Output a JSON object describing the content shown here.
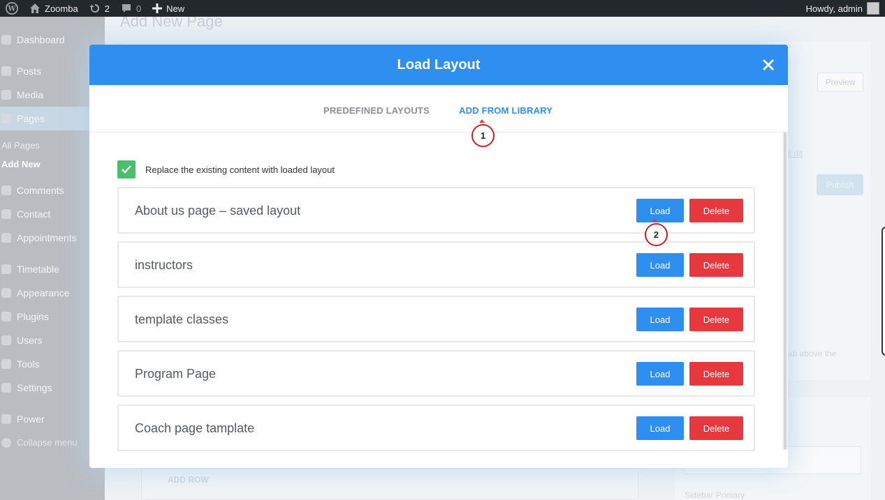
{
  "adminbar": {
    "site_name": "Zoomba",
    "updates_count": "2",
    "comments_count": "0",
    "new_label": "New",
    "greeting": "Howdy, admin"
  },
  "sidebar": {
    "items": [
      {
        "label": "Dashboard"
      },
      {
        "label": "Posts"
      },
      {
        "label": "Media"
      },
      {
        "label": "Pages"
      },
      {
        "label": "Comments"
      },
      {
        "label": "Contact"
      },
      {
        "label": "Appointments"
      },
      {
        "label": "Timetable"
      },
      {
        "label": "Appearance"
      },
      {
        "label": "Plugins"
      },
      {
        "label": "Users"
      },
      {
        "label": "Tools"
      },
      {
        "label": "Settings"
      },
      {
        "label": "Power"
      },
      {
        "label": "Collapse menu"
      }
    ],
    "sub_items": [
      "All Pages",
      "Add New"
    ]
  },
  "background": {
    "page_title": "Add New Page",
    "preview_label": "Preview",
    "edit_label": "Edit",
    "publish_label": "Publish",
    "hint_text": "ab above the",
    "add_row_label": "ADD ROW",
    "sidebar_primary_label": "Sidebar Primary"
  },
  "modal": {
    "title": "Load Layout",
    "tabs": [
      "PREDEFINED LAYOUTS",
      "ADD FROM LIBRARY"
    ],
    "active_tab": "ADD FROM LIBRARY",
    "replace_checkbox_label": "Replace the existing content with loaded layout",
    "replace_checked": true,
    "load_label": "Load",
    "delete_label": "Delete",
    "layouts": [
      {
        "name": "About us page – saved layout"
      },
      {
        "name": "instructors"
      },
      {
        "name": "template classes"
      },
      {
        "name": "Program Page"
      },
      {
        "name": "Coach page tamplate"
      }
    ]
  },
  "annotations": [
    "1",
    "2"
  ],
  "colors": {
    "primary": "#2e8ff0",
    "danger": "#e5393f",
    "success": "#4bc06a",
    "adminbar": "#23282d",
    "marker": "#cc1f1f"
  }
}
